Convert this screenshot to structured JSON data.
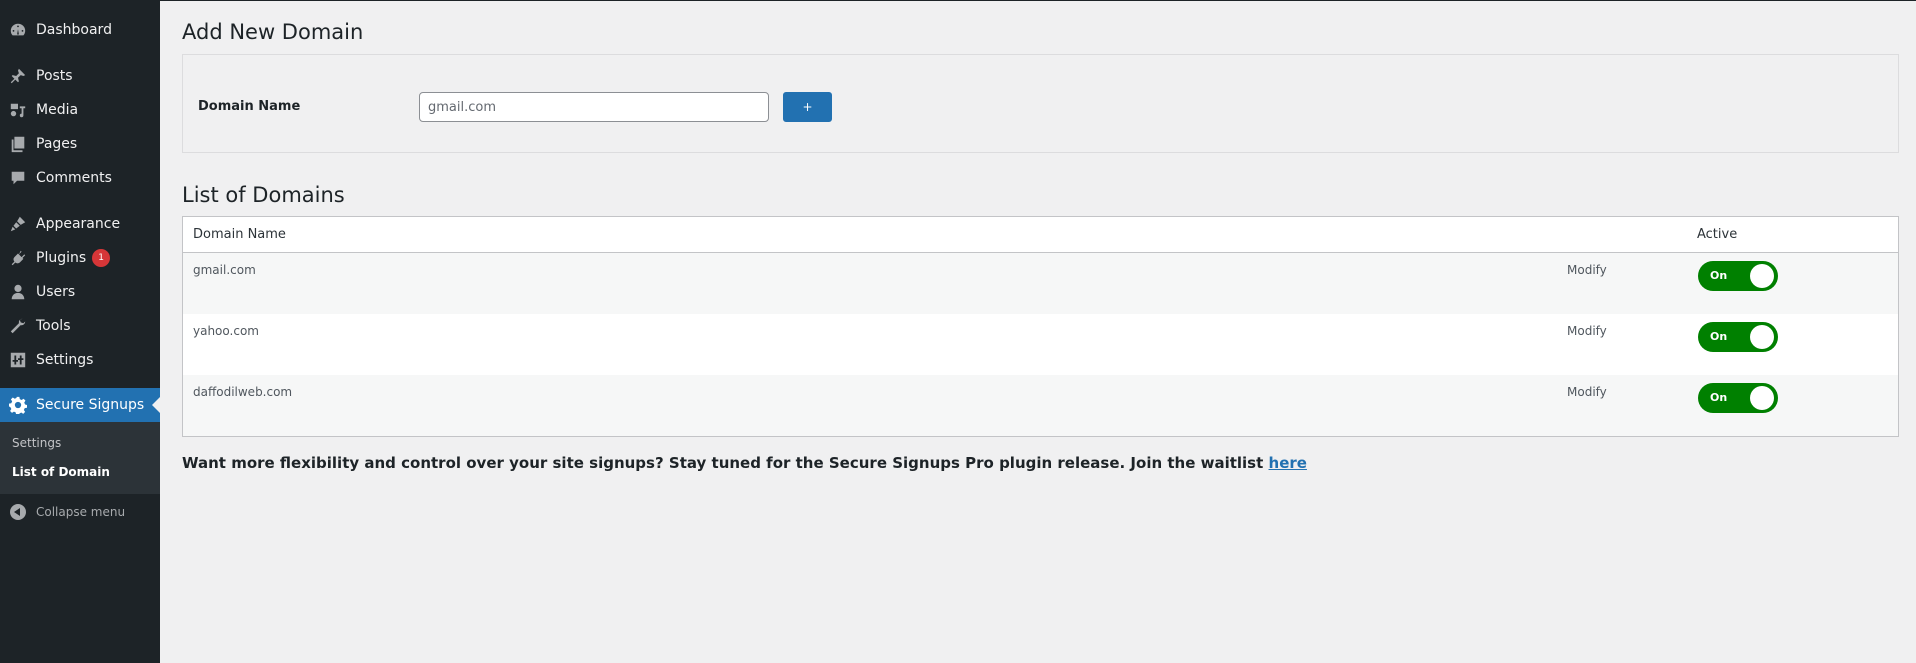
{
  "sidebar": {
    "items": [
      {
        "label": "Dashboard",
        "icon": "dashboard-icon"
      },
      {
        "label": "Posts",
        "icon": "pushpin-icon"
      },
      {
        "label": "Media",
        "icon": "media-icon"
      },
      {
        "label": "Pages",
        "icon": "pages-icon"
      },
      {
        "label": "Comments",
        "icon": "comment-icon"
      },
      {
        "label": "Appearance",
        "icon": "paintbrush-icon"
      },
      {
        "label": "Plugins",
        "icon": "plugin-icon",
        "badge": "1"
      },
      {
        "label": "Users",
        "icon": "user-icon"
      },
      {
        "label": "Tools",
        "icon": "wrench-icon"
      },
      {
        "label": "Settings",
        "icon": "settings-sliders-icon"
      },
      {
        "label": "Secure Signups",
        "icon": "gear-icon",
        "current": true
      }
    ],
    "submenu": [
      {
        "label": "Settings"
      },
      {
        "label": "List of Domain",
        "current": true
      }
    ],
    "collapse_label": "Collapse menu"
  },
  "add_section": {
    "title": "Add New Domain",
    "field_label": "Domain Name",
    "input_value": "",
    "input_placeholder": "gmail.com",
    "add_button_label": "+"
  },
  "list_section": {
    "title": "List of Domains",
    "columns": [
      "Domain Name",
      "",
      "Active"
    ],
    "rows": [
      {
        "domain": "gmail.com",
        "action": "Modify",
        "active": "On"
      },
      {
        "domain": "yahoo.com",
        "action": "Modify",
        "active": "On"
      },
      {
        "domain": "daffodilweb.com",
        "action": "Modify",
        "active": "On"
      }
    ]
  },
  "promo": {
    "text": "Want more flexibility and control over your site signups? Stay tuned for the Secure Signups Pro plugin release. Join the waitlist ",
    "link_label": "here"
  },
  "colors": {
    "sidebar_bg": "#1d2327",
    "accent": "#2271b1",
    "toggle_on": "#008000",
    "badge": "#d63638"
  }
}
